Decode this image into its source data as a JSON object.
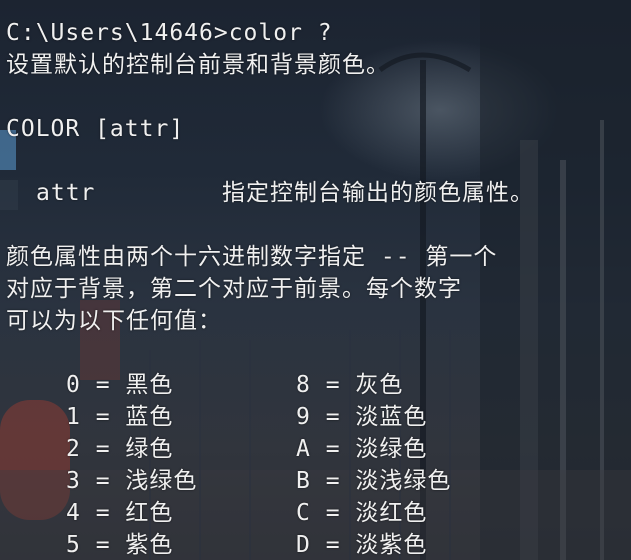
{
  "terminal": {
    "prompt_line": "C:\\Users\\14646>color ?",
    "description": "设置默认的控制台前景和背景颜色。",
    "syntax": "COLOR [attr]",
    "param_name": "attr",
    "param_desc": "指定控制台输出的颜色属性。",
    "explain": [
      "颜色属性由两个十六进制数字指定 -- 第一个",
      "对应于背景，第二个对应于前景。每个数字",
      "可以为以下任何值："
    ],
    "colors_left": [
      "0 = 黑色",
      "1 = 蓝色",
      "2 = 绿色",
      "3 = 浅绿色",
      "4 = 红色",
      "5 = 紫色"
    ],
    "colors_right": [
      "8 = 灰色",
      "9 = 淡蓝色",
      "A = 淡绿色",
      "B = 淡浅绿色",
      "C = 淡红色",
      "D = 淡紫色"
    ]
  },
  "theme": {
    "text_color": "#f0f0f0",
    "background_top": "#1c2431",
    "background_bottom": "#2b2f36"
  }
}
